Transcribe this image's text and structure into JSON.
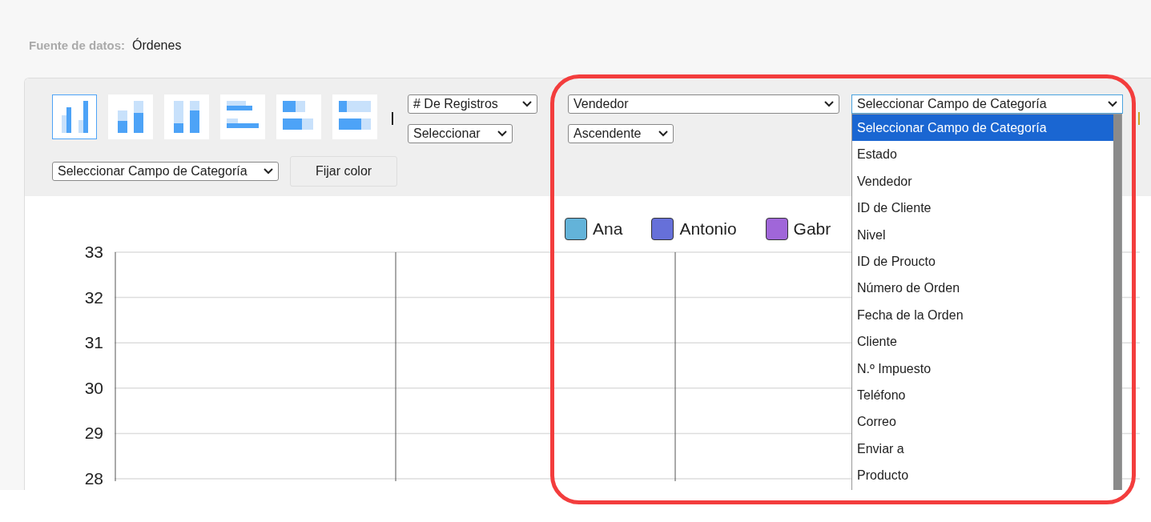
{
  "source": {
    "label": "Fuente de datos:",
    "value": "Órdenes"
  },
  "chart_types": [
    {
      "kind": "column",
      "selected": true
    },
    {
      "kind": "stacked-column",
      "selected": false
    },
    {
      "kind": "full-column",
      "selected": false
    },
    {
      "kind": "bar",
      "selected": false
    },
    {
      "kind": "stacked-bar",
      "selected": false
    },
    {
      "kind": "full-bar",
      "selected": false
    }
  ],
  "measure_select": {
    "value": "# De Registros"
  },
  "aggregate_select": {
    "value": "Seleccionar"
  },
  "category_select": {
    "value": "Vendedor"
  },
  "sort_select": {
    "value": "Ascendente"
  },
  "group_select": {
    "value": "Seleccionar Campo de Categoría",
    "expanded": true,
    "options": [
      {
        "label": "Seleccionar Campo de Categoría",
        "selected": true
      },
      {
        "label": "Estado",
        "selected": false
      },
      {
        "label": "Vendedor",
        "selected": false
      },
      {
        "label": "ID de Cliente",
        "selected": false
      },
      {
        "label": "Nivel",
        "selected": false
      },
      {
        "label": "ID de Proucto",
        "selected": false
      },
      {
        "label": "Número de Orden",
        "selected": false
      },
      {
        "label": "Fecha de la Orden",
        "selected": false
      },
      {
        "label": "Cliente",
        "selected": false
      },
      {
        "label": "N.º Impuesto",
        "selected": false
      },
      {
        "label": "Teléfono",
        "selected": false
      },
      {
        "label": "Correo",
        "selected": false
      },
      {
        "label": "Enviar a",
        "selected": false
      },
      {
        "label": "Producto",
        "selected": false
      }
    ]
  },
  "color_field_select": {
    "value": "Seleccionar Campo de Categoría"
  },
  "color_button": {
    "label": "Fijar color"
  },
  "legend": [
    {
      "label": "Ana",
      "color": "#63b3d9"
    },
    {
      "label": "Antonio",
      "color": "#6670d9"
    },
    {
      "label": "Gabr",
      "color": "#a066d9"
    }
  ],
  "y_axis_ticks": [
    "33",
    "32",
    "31",
    "30",
    "29",
    "28"
  ]
}
